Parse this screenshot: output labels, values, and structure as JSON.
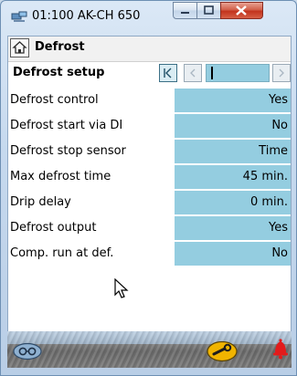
{
  "window": {
    "title": "01:100 AK-CH 650"
  },
  "screen": {
    "title": "Defrost",
    "section_title": "Defrost setup"
  },
  "rows": [
    {
      "label": "Defrost control",
      "value": "Yes"
    },
    {
      "label": "Defrost start via DI",
      "value": "No"
    },
    {
      "label": "Defrost stop sensor",
      "value": "Time"
    },
    {
      "label": "Max defrost time",
      "value": "45 min."
    },
    {
      "label": "Drip delay",
      "value": "0 min."
    },
    {
      "label": "Defrost output",
      "value": "Yes"
    },
    {
      "label": "Comp. run at def.",
      "value": "No"
    }
  ],
  "icons": {
    "app": "network-device-icon",
    "home": "home-icon",
    "first": "first-page-icon",
    "prev": "previous-page-icon",
    "next": "next-page-icon",
    "login": "glasses-login-icon",
    "service": "wrench-icon",
    "alarm": "alarm-bell-icon"
  },
  "colors": {
    "value_cell": "#94cde0",
    "alarm": "#e21b1b",
    "service_button": "#f0b400"
  }
}
